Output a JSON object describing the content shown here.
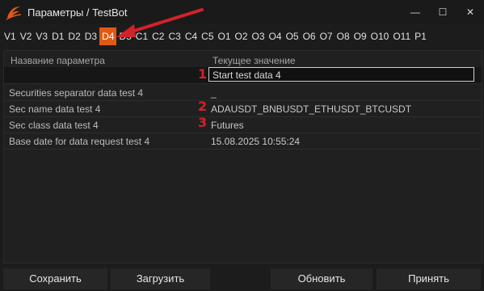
{
  "window": {
    "title": "Параметры / TestBot",
    "controls": {
      "minimize": "—",
      "maximize": "☐",
      "close": "✕"
    }
  },
  "tabs": [
    "V1",
    "V2",
    "V3",
    "D1",
    "D2",
    "D3",
    "D4",
    "D5",
    "C1",
    "C2",
    "C3",
    "C4",
    "C5",
    "O1",
    "O2",
    "O3",
    "O4",
    "O5",
    "O6",
    "O7",
    "O8",
    "O9",
    "O10",
    "O11",
    "P1"
  ],
  "active_tab": "D4",
  "accent_color": "#e05a16",
  "annotation_color": "#d3222a",
  "table": {
    "header_name": "Название параметра",
    "header_value": "Текущее значение",
    "edit_value": "Start test data 4",
    "rows": [
      {
        "name": "Securities separator data test 4",
        "value": "_"
      },
      {
        "name": "Sec name data test 4",
        "value": "ADAUSDT_BNBUSDT_ETHUSDT_BTCUSDT"
      },
      {
        "name": "Sec class data test 4",
        "value": "Futures"
      },
      {
        "name": "Base date for data request test 4",
        "value": "15.08.2025 10:55:24"
      }
    ]
  },
  "annotations": [
    "1",
    "2",
    "3"
  ],
  "buttons": {
    "save": "Сохранить",
    "load": "Загрузить",
    "refresh": "Обновить",
    "apply": "Принять"
  }
}
